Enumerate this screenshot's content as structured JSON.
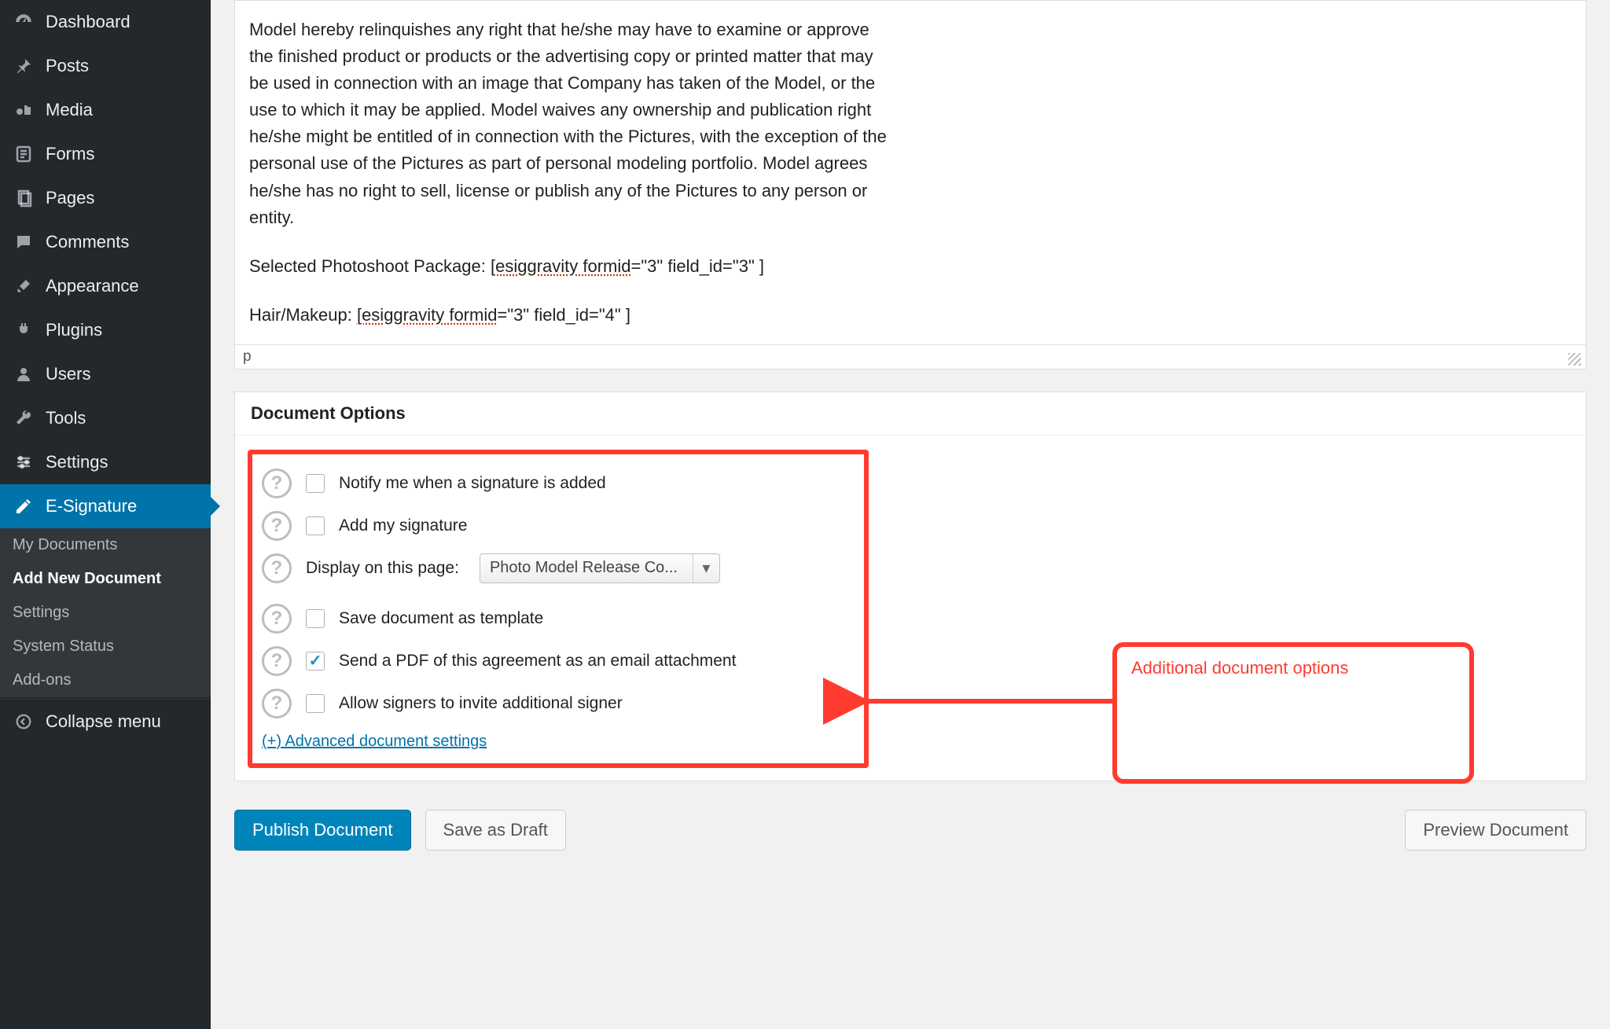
{
  "sidebar": {
    "items": [
      {
        "label": "Dashboard",
        "icon": "dashboard-icon"
      },
      {
        "label": "Posts",
        "icon": "pin-icon"
      },
      {
        "label": "Media",
        "icon": "media-icon"
      },
      {
        "label": "Forms",
        "icon": "forms-icon"
      },
      {
        "label": "Pages",
        "icon": "pages-icon"
      },
      {
        "label": "Comments",
        "icon": "comment-icon"
      },
      {
        "label": "Appearance",
        "icon": "brush-icon"
      },
      {
        "label": "Plugins",
        "icon": "plug-icon"
      },
      {
        "label": "Users",
        "icon": "user-icon"
      },
      {
        "label": "Tools",
        "icon": "wrench-icon"
      },
      {
        "label": "Settings",
        "icon": "sliders-icon"
      },
      {
        "label": "E-Signature",
        "icon": "pencil-icon",
        "active": true
      }
    ],
    "submenu": [
      "My Documents",
      "Add New Document",
      "Settings",
      "System Status",
      "Add-ons"
    ],
    "submenu_current": "Add New Document",
    "collapse_label": "Collapse menu"
  },
  "editor": {
    "body_text": "Model hereby relinquishes any right that he/she may have to examine or approve the finished product or products or the advertising copy or printed matter that may be used in connection with an image that Company has taken of the Model, or the use to which it may be applied. Model waives any ownership and publication right he/she might be entitled of in connection with the Pictures, with the exception of the personal use of the Pictures as part of personal modeling portfolio. Model agrees he/she has no right to sell, license or publish any of the Pictures to any person or entity.",
    "line2_prefix": "Selected Photoshoot Package: ",
    "line2_code_a": "[esiggravity formid",
    "line2_code_b": "=\"3\" field_id=\"3\" ]",
    "line3_prefix": "Hair/Makeup:  ",
    "line3_code_a": "[esiggravity formid",
    "line3_code_b": "=\"3\" field_id=\"4\" ]",
    "path": "p"
  },
  "options": {
    "panel_title": "Document Options",
    "rows": {
      "notify": "Notify me when a signature is added",
      "add_sig": "Add my signature",
      "display_label": "Display on this page:",
      "display_value": "Photo Model Release Co...",
      "save_tpl": "Save document as template",
      "send_pdf": "Send a PDF of this agreement as an email attachment",
      "allow_invite": "Allow signers to invite additional signer"
    },
    "advanced_link": "(+) Advanced document settings",
    "annotation": "Additional document options"
  },
  "actions": {
    "publish": "Publish Document",
    "draft": "Save as Draft",
    "preview": "Preview Document"
  }
}
